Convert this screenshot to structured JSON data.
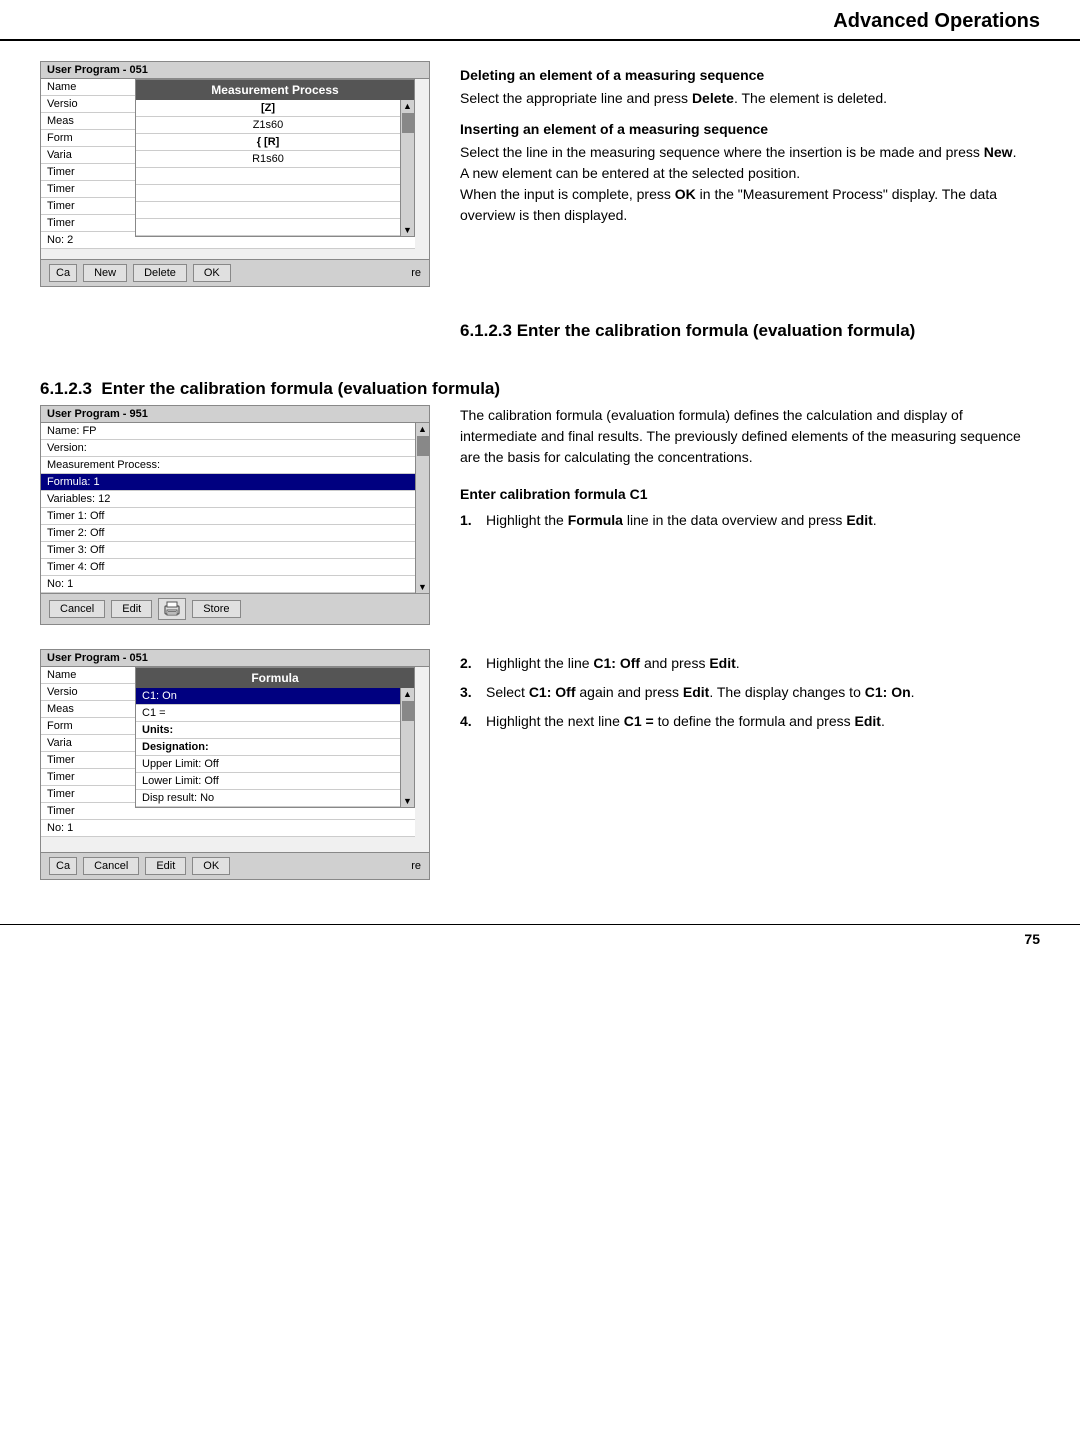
{
  "header": {
    "title": "Advanced Operations"
  },
  "section1": {
    "screenshot1": {
      "title": "Measurement Process",
      "outer_title": "User Program - 051",
      "outer_rows": [
        {
          "label": "Name",
          "partial": true
        },
        {
          "label": "Versio",
          "partial": true
        },
        {
          "label": "Meas",
          "partial": true
        },
        {
          "label": "Form",
          "partial": true
        },
        {
          "label": "Varia",
          "partial": true
        },
        {
          "label": "Timer",
          "partial": true
        },
        {
          "label": "Timer",
          "partial": true
        },
        {
          "label": "Timer",
          "partial": true
        },
        {
          "label": "Timer",
          "partial": true
        },
        {
          "label": "No: 2",
          "partial": true
        }
      ],
      "inner_rows": [
        {
          "label": "[Z]",
          "center": true,
          "bold": true
        },
        {
          "label": "Z1s60",
          "center": true
        },
        {
          "label": "{ [R]",
          "center": true,
          "bold": true
        },
        {
          "label": "R1s60",
          "center": true
        }
      ],
      "footer_buttons": [
        "Ca",
        "New",
        "Delete",
        "OK",
        "re"
      ]
    },
    "right_heading1": "Deleting an element of a measuring sequence",
    "right_text1": "Select the appropriate line and press Delete. The element is deleted.",
    "right_heading2": "Inserting an element of a measuring sequence",
    "right_text2": "Select the line in the measuring sequence where the insertion is be made and press New.",
    "right_text3": "A new element can be entered at the selected position.",
    "right_text4": "When the input is complete, press OK in the \"Measurement Process\" display. The data overview is then displayed."
  },
  "section2": {
    "heading": "6.1.2.3  Enter the calibration formula (evaluation formula)",
    "body": "The calibration formula (evaluation formula) defines the calculation and display of intermediate and final results. The previously defined elements of the measuring sequence are the basis for calculating the concentrations."
  },
  "section3": {
    "screenshot2": {
      "title": "User Program - 951",
      "rows": [
        {
          "label": "Name: FP"
        },
        {
          "label": "Version:"
        },
        {
          "label": "Measurement Process:"
        },
        {
          "label": "Formula: 1",
          "selected": true
        },
        {
          "label": "Variables: 12"
        },
        {
          "label": "Timer 1: Off"
        },
        {
          "label": "Timer 2: Off"
        },
        {
          "label": "Timer 3: Off"
        },
        {
          "label": "Timer 4: Off"
        },
        {
          "label": "No: 1"
        }
      ],
      "footer_buttons": [
        "Cancel",
        "Edit",
        "store_icon",
        "Store"
      ]
    },
    "right_heading": "Enter calibration formula C1",
    "step1_num": "1.",
    "step1_text": "Highlight the Formula line in the data overview and press Edit."
  },
  "section4": {
    "screenshot3": {
      "outer_title": "User Program - 051",
      "inner_title": "Formula",
      "outer_rows": [
        {
          "label": "Name",
          "partial": true
        },
        {
          "label": "Versio",
          "partial": true
        },
        {
          "label": "Meas",
          "partial": true
        },
        {
          "label": "Form",
          "partial": true
        },
        {
          "label": "Varia",
          "partial": true
        },
        {
          "label": "Timer",
          "partial": true
        },
        {
          "label": "Timer",
          "partial": true
        },
        {
          "label": "Timer",
          "partial": true
        },
        {
          "label": "Timer",
          "partial": true
        },
        {
          "label": "No: 1"
        }
      ],
      "inner_rows": [
        {
          "label": "C1: On",
          "selected": true
        },
        {
          "label": "C1 ="
        },
        {
          "label": "Units:",
          "bold": true
        },
        {
          "label": "Designation:",
          "bold": true
        },
        {
          "label": "Upper Limit: Off"
        },
        {
          "label": "Lower Limit: Off"
        },
        {
          "label": "Disp result: No"
        }
      ],
      "footer_buttons": [
        "Ca",
        "Cancel",
        "Edit",
        "OK",
        "re"
      ]
    },
    "step2_num": "2.",
    "step2_text": "Highlight the line C1: Off and press Edit.",
    "step3_num": "3.",
    "step3_text_part1": "Select C1: Off again and press Edit. The display changes to",
    "step3_bold": "C1: On",
    "step3_text_part2": ".",
    "step4_num": "4.",
    "step4_text_part1": "Highlight the next line C1 = to define the formula and press",
    "step4_bold": "Edit",
    "step4_text_part2": "."
  },
  "footer": {
    "page_number": "75"
  }
}
